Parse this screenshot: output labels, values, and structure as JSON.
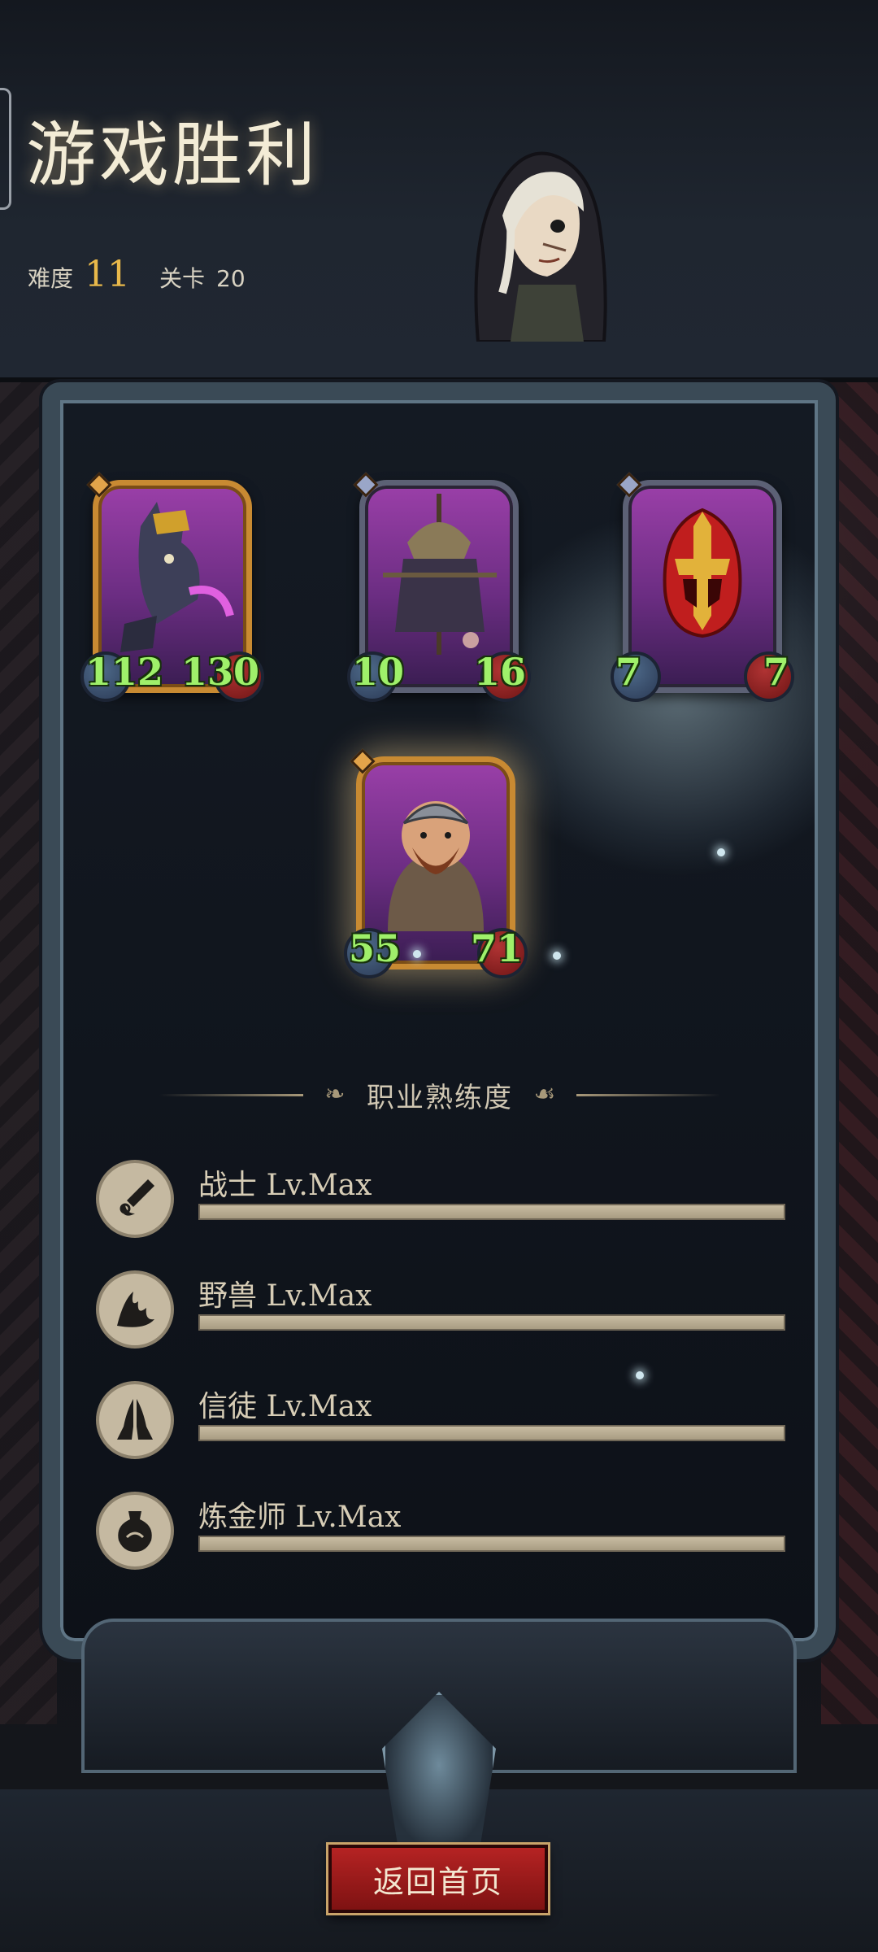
{
  "header": {
    "title": "游戏胜利",
    "difficulty_label": "难度",
    "difficulty_value": "11",
    "stage_label": "关卡",
    "stage_value": "20"
  },
  "cards": [
    {
      "name": "anubis-beast",
      "attack": "112",
      "health": "130",
      "frame": "gold"
    },
    {
      "name": "scarecrow",
      "attack": "10",
      "health": "16",
      "frame": "silver"
    },
    {
      "name": "golden-helmet",
      "attack": "7",
      "health": "7",
      "frame": "silver"
    },
    {
      "name": "bearded-brute",
      "attack": "55",
      "health": "71",
      "frame": "gold"
    }
  ],
  "proficiency": {
    "title": "职业熟练度",
    "items": [
      {
        "label": "战士 Lv.Max",
        "icon": "warrior-icon",
        "progress": 1.0
      },
      {
        "label": "野兽 Lv.Max",
        "icon": "beast-icon",
        "progress": 1.0
      },
      {
        "label": "信徒 Lv.Max",
        "icon": "believer-icon",
        "progress": 1.0
      },
      {
        "label": "炼金师 Lv.Max",
        "icon": "alchemist-icon",
        "progress": 1.0
      }
    ]
  },
  "button": {
    "home_label": "返回首页"
  },
  "colors": {
    "accent_gold": "#e8b84a",
    "stat_green": "#9ff06a",
    "button_red": "#b52323",
    "bar_fill": "#c8bca2"
  }
}
